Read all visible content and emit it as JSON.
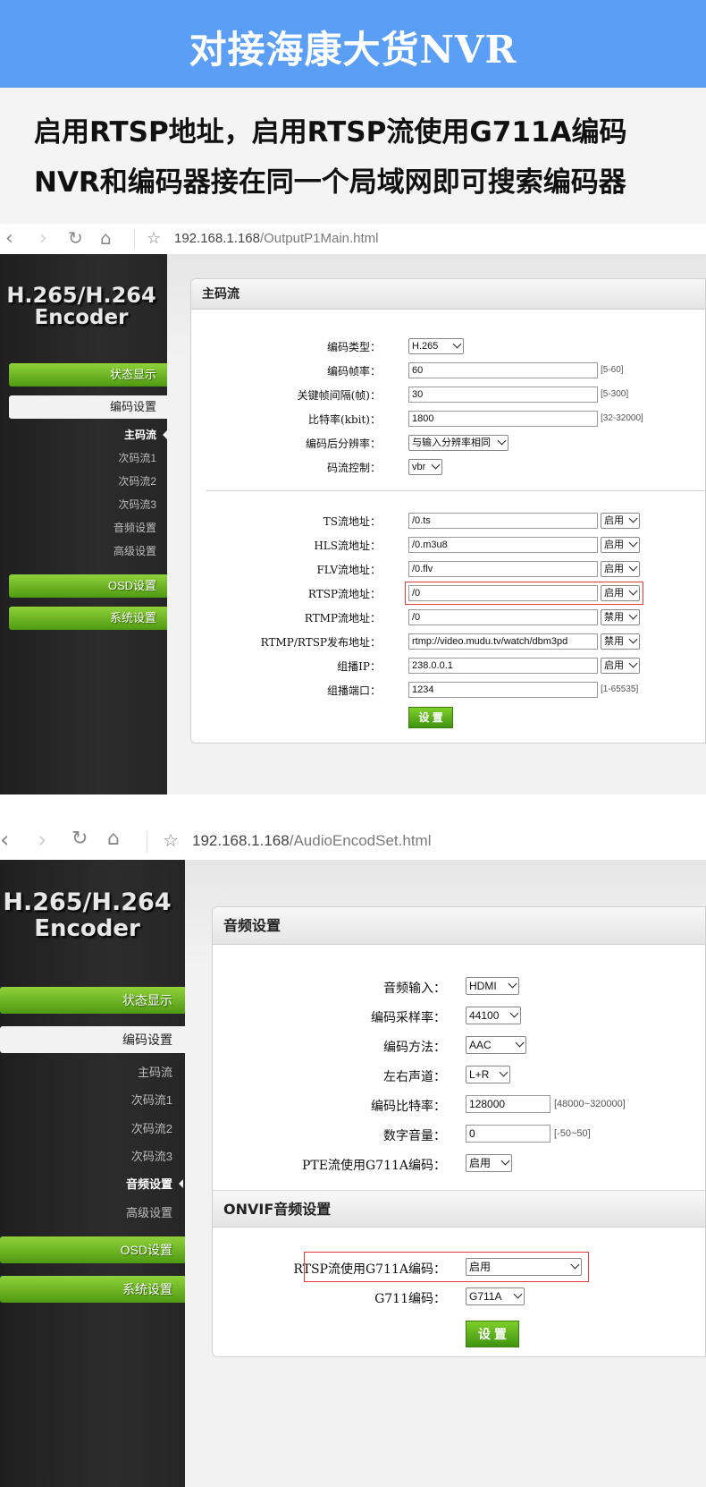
{
  "banner": {
    "title": "对接海康大货NVR"
  },
  "intro": {
    "line1": "启用RTSP地址，启用RTSP流使用G711A编码",
    "line2": "NVR和编码器接在同一个局域网即可搜索编码器"
  },
  "shot1": {
    "url_host": "192.168.1.168",
    "url_path": "/OutputP1Main.html",
    "logo_line1": "H.265/H.264",
    "logo_line2": "Encoder",
    "sidebar": {
      "status": "状态显示",
      "encode": "编码设置",
      "sub": [
        "主码流",
        "次码流1",
        "次码流2",
        "次码流3",
        "音频设置",
        "高级设置"
      ],
      "osd": "OSD设置",
      "system": "系统设置"
    },
    "panel_title": "主码流",
    "rows1": [
      {
        "label": "编码类型：",
        "select": "H.265"
      },
      {
        "label": "编码帧率：",
        "input": "60",
        "hint": "[5-60]"
      },
      {
        "label": "关键帧间隔(帧)：",
        "input": "30",
        "hint": "[5-300]"
      },
      {
        "label": "比特率(kbit)：",
        "input": "1800",
        "hint": "[32-32000]"
      },
      {
        "label": "编码后分辨率：",
        "select": "与输入分辨率相同"
      },
      {
        "label": "码流控制：",
        "select": "vbr"
      }
    ],
    "rows2": [
      {
        "label": "TS流地址：",
        "input": "/0.ts",
        "select": "启用"
      },
      {
        "label": "HLS流地址：",
        "input": "/0.m3u8",
        "select": "启用"
      },
      {
        "label": "FLV流地址：",
        "input": "/0.flv",
        "select": "启用"
      },
      {
        "label": "RTSP流地址：",
        "input": "/0",
        "select": "启用"
      },
      {
        "label": "RTMP流地址：",
        "input": "/0",
        "select": "禁用"
      },
      {
        "label": "RTMP/RTSP发布地址：",
        "input": "rtmp://video.mudu.tv/watch/dbm3pd",
        "select": "禁用"
      },
      {
        "label": "组播IP：",
        "input": "238.0.0.1",
        "select": "启用"
      },
      {
        "label": "组播端口：",
        "input": "1234",
        "hint": "[1-65535]"
      }
    ],
    "submit": "设 置"
  },
  "shot2": {
    "url_host": "192.168.1.168",
    "url_path": "/AudioEncodSet.html",
    "logo_line1": "H.265/H.264",
    "logo_line2": "Encoder",
    "sidebar": {
      "status": "状态显示",
      "encode": "编码设置",
      "sub": [
        "主码流",
        "次码流1",
        "次码流2",
        "次码流3",
        "音频设置",
        "高级设置"
      ],
      "osd": "OSD设置",
      "system": "系统设置"
    },
    "panel_title": "音频设置",
    "rows1": [
      {
        "label": "音频输入：",
        "select": "HDMI"
      },
      {
        "label": "编码采样率：",
        "select": "44100"
      },
      {
        "label": "编码方法：",
        "select": "AAC"
      },
      {
        "label": "左右声道：",
        "select": "L+R"
      },
      {
        "label": "编码比特率：",
        "input": "128000",
        "hint": "[48000~320000]"
      },
      {
        "label": "数字音量：",
        "input": "0",
        "hint": "[-50~50]"
      },
      {
        "label": "PTE流使用G711A编码：",
        "select": "启用"
      }
    ],
    "onvif_title": "ONVIF音频设置",
    "rows2": [
      {
        "label": "RTSP流使用G711A编码：",
        "select": "启用"
      },
      {
        "label": "G711编码：",
        "select": "G711A"
      }
    ],
    "submit": "设 置"
  }
}
